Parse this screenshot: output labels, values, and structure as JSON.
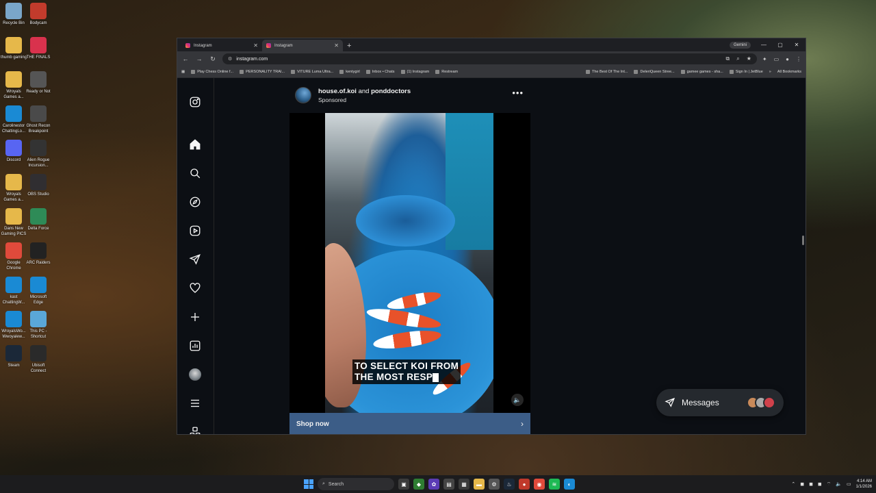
{
  "desktop": {
    "icons": [
      {
        "label": "Recycle Bin",
        "icon": "recycle-bin-icon",
        "color": "#7aa6c9"
      },
      {
        "label": "Bodycam",
        "icon": "bodycam-icon",
        "color": "#c23b2c"
      },
      {
        "label": "thumb gaming",
        "icon": "folder-icon",
        "color": "#e6b84a"
      },
      {
        "label": "THE FINALS",
        "icon": "the-finals-icon",
        "color": "#d9324d"
      },
      {
        "label": "Wroyals Games a...",
        "icon": "folder-icon",
        "color": "#e6b84a"
      },
      {
        "label": "Ready or Not",
        "icon": "ready-or-not-icon",
        "color": "#555"
      },
      {
        "label": "Carolinestor ChattingLo...",
        "icon": "edge-icon",
        "color": "#1a8ad4"
      },
      {
        "label": "Ghost Recon Breakpoint",
        "icon": "ghost-recon-icon",
        "color": "#4a4a4a"
      },
      {
        "label": "Discord",
        "icon": "discord-icon",
        "color": "#5865f2"
      },
      {
        "label": "Alien Rogue Incursion...",
        "icon": "alien-rogue-icon",
        "color": "#333"
      },
      {
        "label": "Wroyals Games a...",
        "icon": "folder-icon",
        "color": "#e6b84a"
      },
      {
        "label": "OBS Studio",
        "icon": "obs-icon",
        "color": "#302e31"
      },
      {
        "label": "Dans New Gaming PICS",
        "icon": "folder-icon",
        "color": "#e6b84a"
      },
      {
        "label": "Delta Force",
        "icon": "delta-force-icon",
        "color": "#2e8b57"
      },
      {
        "label": "Google Chrome",
        "icon": "chrome-icon",
        "color": "#e04a3b"
      },
      {
        "label": "ARC Raiders",
        "icon": "arc-raiders-icon",
        "color": "#222"
      },
      {
        "label": "kast ChattingW...",
        "icon": "edge-icon",
        "color": "#1a8ad4"
      },
      {
        "label": "Microsoft Edge",
        "icon": "edge-icon",
        "color": "#1a8ad4"
      },
      {
        "label": "WroyalsWo... Wwoyalew...",
        "icon": "edge-icon",
        "color": "#1a8ad4"
      },
      {
        "label": "This PC - Shortcut",
        "icon": "this-pc-icon",
        "color": "#5aa7d8"
      },
      {
        "label": "Steam",
        "icon": "steam-icon",
        "color": "#1b2838"
      },
      {
        "label": "Ubisoft Connect",
        "icon": "ubisoft-icon",
        "color": "#2a2a2a"
      }
    ]
  },
  "browser": {
    "tabs": [
      {
        "title": "Instagram",
        "active": false
      },
      {
        "title": "Instagram",
        "active": true
      }
    ],
    "gemini_label": "Gemini",
    "url": "instagram.com",
    "bookmarks": [
      "Play Chess Online f...",
      "PERSONALITY TRAI...",
      "VITURE Luma Ultra...",
      "kentygirl",
      "Inbox • Chats",
      "(1) Instagram",
      "Restream",
      "The Best Of The Int...",
      "DeleriQueen Stree...",
      "gamee games - sha...",
      "Sign In | JetBlue"
    ],
    "all_bookmarks": "All Bookmarks"
  },
  "post": {
    "user1": "house.of.koi",
    "joiner": " and ",
    "user2": "ponddoctors",
    "sponsored": "Sponsored",
    "caption_line1": "TO SELECT KOI FROM",
    "caption_line2": "THE MOST RESP",
    "shop_label": "Shop now"
  },
  "messages": {
    "label": "Messages",
    "avatar_colors": [
      "#c98a5a",
      "#a9a9a9",
      "#d0414b"
    ]
  },
  "taskbar": {
    "search_placeholder": "Search",
    "time": "4:14 AM",
    "date": "1/1/2026"
  }
}
